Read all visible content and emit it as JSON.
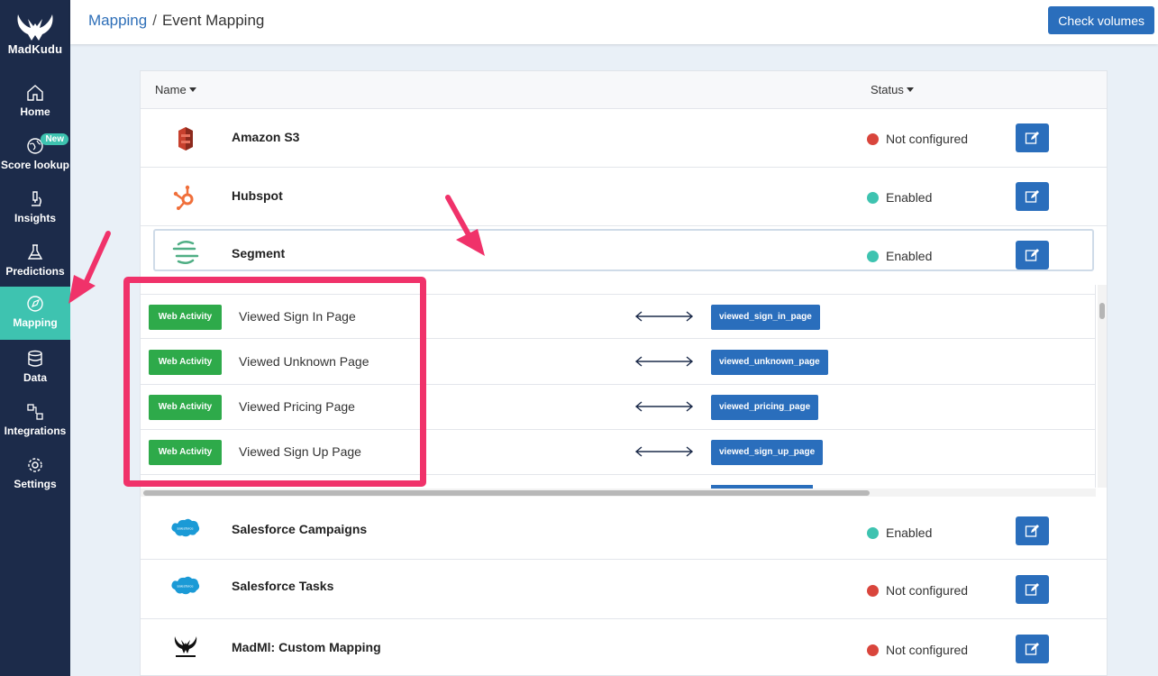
{
  "brand": {
    "name": "MadKudu"
  },
  "sidebar": {
    "items": [
      {
        "label": "Home",
        "icon": "home-icon"
      },
      {
        "label": "Score lookup",
        "icon": "globe-icon",
        "badge": "New"
      },
      {
        "label": "Insights",
        "icon": "microscope-icon"
      },
      {
        "label": "Predictions",
        "icon": "flask-icon"
      },
      {
        "label": "Mapping",
        "icon": "compass-icon",
        "active": true
      },
      {
        "label": "Data",
        "icon": "database-icon"
      },
      {
        "label": "Integrations",
        "icon": "integrations-icon"
      },
      {
        "label": "Settings",
        "icon": "gear-icon"
      }
    ]
  },
  "header": {
    "breadcrumb_parent": "Mapping",
    "breadcrumb_separator": "/",
    "breadcrumb_current": "Event Mapping",
    "check_volumes": "Check volumes"
  },
  "table": {
    "col_name": "Name",
    "col_status": "Status",
    "rows": [
      {
        "name": "Amazon S3",
        "status": "Not configured",
        "logo": "amazon-s3-icon"
      },
      {
        "name": "Hubspot",
        "status": "Enabled",
        "logo": "hubspot-icon"
      },
      {
        "name": "Segment",
        "status": "Enabled",
        "logo": "segment-icon"
      },
      {
        "name": "Salesforce Campaigns",
        "status": "Enabled",
        "logo": "salesforce-icon"
      },
      {
        "name": "Salesforce Tasks",
        "status": "Not configured",
        "logo": "salesforce-icon"
      },
      {
        "name": "MadMl: Custom Mapping",
        "status": "Not configured",
        "logo": "madkudu-icon"
      }
    ],
    "status_colors": {
      "Enabled": "#3ec3b0",
      "Not configured": "#d9453c"
    }
  },
  "segment_mappings": [
    {
      "type": "Web Activity",
      "event": "Viewed Sign In Page",
      "key": "viewed_sign_in_page"
    },
    {
      "type": "Web Activity",
      "event": "Viewed Unknown Page",
      "key": "viewed_unknown_page"
    },
    {
      "type": "Web Activity",
      "event": "Viewed Pricing Page",
      "key": "viewed_pricing_page"
    },
    {
      "type": "Web Activity",
      "event": "Viewed Sign Up Page",
      "key": "viewed_sign_up_page"
    }
  ],
  "salesforce_logo_text": "salesforce",
  "colors": {
    "sidebar_bg": "#1c2b4a",
    "active_nav": "#3ec3b0",
    "primary": "#2a6ebc",
    "web_activity": "#2eaa4a",
    "annotation": "#f0326a"
  }
}
